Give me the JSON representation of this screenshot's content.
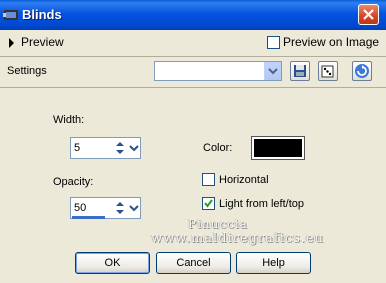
{
  "window": {
    "title": "Blinds",
    "icon": "psp-app-icon"
  },
  "preview_bar": {
    "label": "Preview",
    "preview_on_image_label": "Preview on Image",
    "preview_on_image_checked": false
  },
  "settings_bar": {
    "label": "Settings",
    "preset_value": "",
    "buttons": [
      "save-preset-icon",
      "random-dice-icon",
      "reset-icon"
    ]
  },
  "controls": {
    "width_label": "Width:",
    "width_value": "5",
    "opacity_label": "Opacity:",
    "opacity_value": "50",
    "opacity_fraction": 0.5,
    "color_label": "Color:",
    "color_value": "#000000",
    "horizontal_label": "Horizontal",
    "horizontal_checked": false,
    "light_label": "Light from left/top",
    "light_checked": true
  },
  "watermark": {
    "line1": "Pinuccia",
    "line2": "www.maldiregrafics.eu"
  },
  "buttons": {
    "ok": "OK",
    "cancel": "Cancel",
    "help": "Help"
  },
  "colors": {
    "titlebar": "#0554e0",
    "dialog_bg": "#ece9d8",
    "close": "#d2452a",
    "border": "#7f9db9"
  }
}
